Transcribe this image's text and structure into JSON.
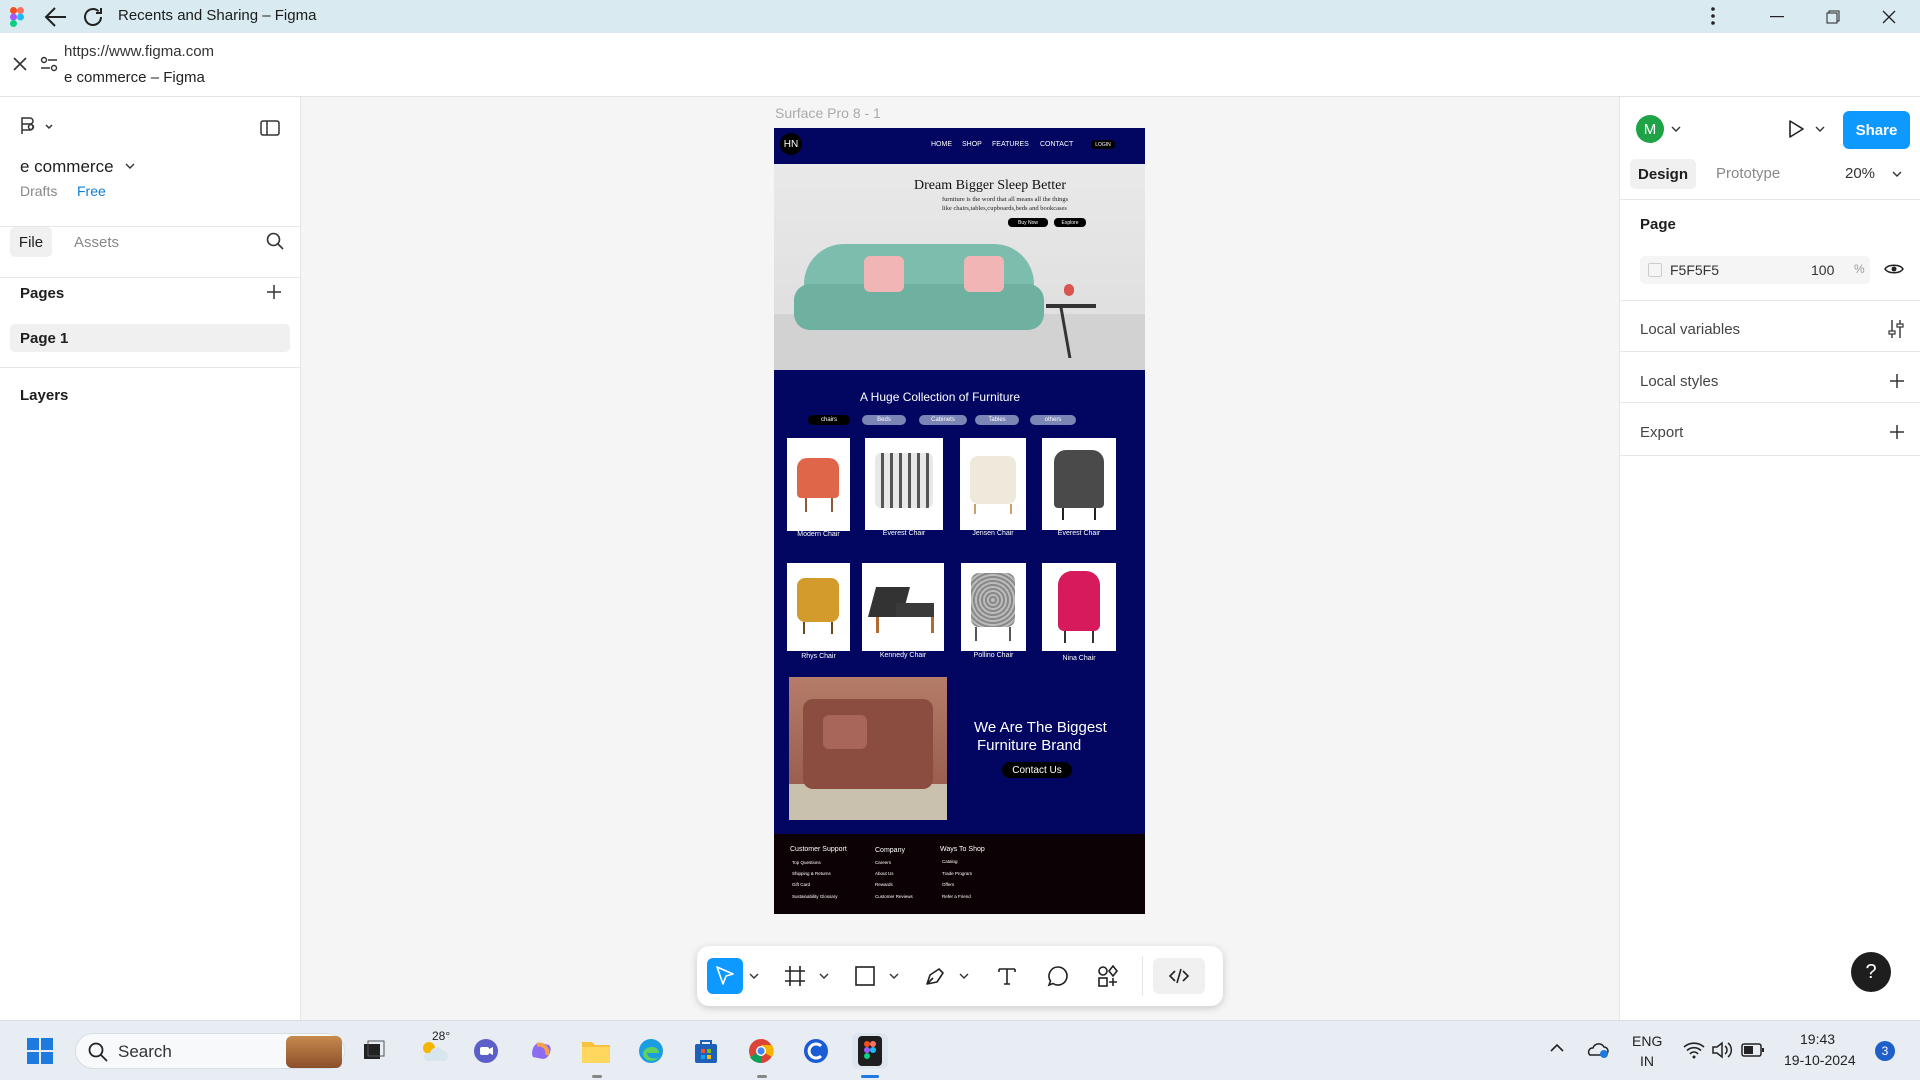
{
  "titlebar": {
    "title": "Recents and Sharing – Figma"
  },
  "address": {
    "url": "https://www.figma.com",
    "page_title": "e commerce – Figma"
  },
  "left_panel": {
    "file_name": "e commerce",
    "location": "Drafts",
    "plan": "Free",
    "tabs": [
      "File",
      "Assets"
    ],
    "pages_heading": "Pages",
    "pages": [
      "Page 1"
    ],
    "layers_heading": "Layers"
  },
  "canvas": {
    "frame_label": "Surface Pro 8 - 1",
    "site": {
      "logo": "HN",
      "nav": [
        "HOME",
        "SHOP",
        "FEATURES",
        "CONTACT"
      ],
      "login": "LOGIN",
      "hero_title": "Dream Bigger Sleep Better",
      "hero_text_1": "furniture is the word that all means all the things",
      "hero_text_2": "like chairs,tables,cupboards,beds and bookcases",
      "hero_btn_1": "Buy Now",
      "hero_btn_2": "Explore",
      "collection_title": "A Huge Collection of Furniture",
      "categories": [
        "chairs",
        "Beds",
        "Cabinets",
        "Tables",
        "others"
      ],
      "products_row1": [
        "Modern Chair",
        "Everest Chair",
        "Jensen Chair",
        "Everest Chair"
      ],
      "products_row2": [
        "Rhys Chair",
        "Kennedy Chair",
        "Pollino Chair",
        "Nina Chair"
      ],
      "brand_title_1": "We Are The Biggest",
      "brand_title_2": "Furniture Brand",
      "contact_btn": "Contact Us",
      "footer": {
        "col1": {
          "heading": "Customer Support",
          "items": [
            "Top Questions",
            "Shipping & Returns",
            "Gift Card",
            "Sustainability Glossary"
          ]
        },
        "col2": {
          "heading": "Company",
          "items": [
            "Careers",
            "About Us",
            "Rewards",
            "Customer Reviews"
          ]
        },
        "col3": {
          "heading": "Ways To Shop",
          "items": [
            "Catalog",
            "Trade Program",
            "Offers",
            "Refer a Friend"
          ]
        }
      }
    }
  },
  "right_panel": {
    "avatar": "M",
    "share": "Share",
    "tabs": [
      "Design",
      "Prototype"
    ],
    "zoom": "20%",
    "page_heading": "Page",
    "page_color": "F5F5F5",
    "page_opacity": "100",
    "percent": "%",
    "sections": [
      "Local variables",
      "Local styles",
      "Export"
    ]
  },
  "help": "?",
  "taskbar": {
    "search": "Search",
    "weather": "28°",
    "lang_1": "ENG",
    "lang_2": "IN",
    "time": "19:43",
    "date": "19-10-2024",
    "notifications": "3"
  },
  "colors": {
    "frame_bg": "#020660",
    "footer_bg": "#0c0206",
    "share_blue": "#0d99ff",
    "select_blue": "#0d99ff"
  }
}
